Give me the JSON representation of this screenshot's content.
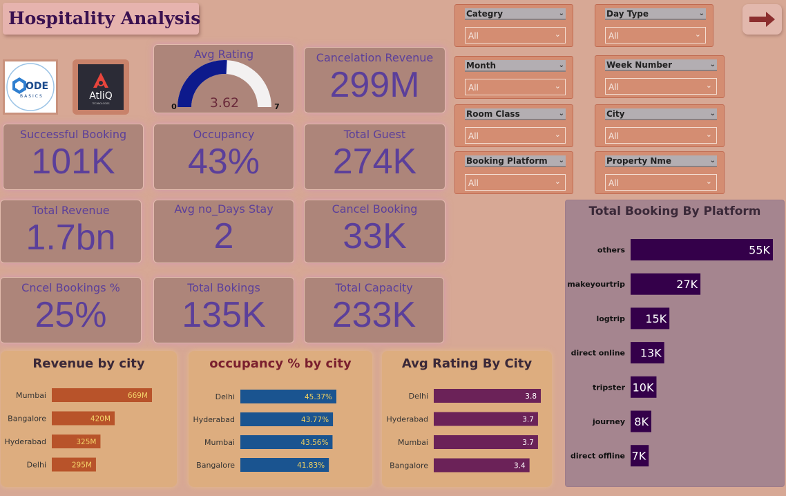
{
  "title": "Hospitality Analysis",
  "logos": {
    "codebasics_word1": "ODE",
    "codebasics_word2": "BASICS",
    "atliq": "AtliQ",
    "atliq_sub": "TECHNOLOGIES"
  },
  "kpis": {
    "avg_rating": {
      "label": "Avg Rating",
      "value": "3.62",
      "min": "0",
      "max": "7",
      "gauge_value": 3.62,
      "gauge_max": 7
    },
    "cancelation_revenue": {
      "label": "Cancelation Revenue",
      "value": "299M"
    },
    "successful_booking": {
      "label": "Successful Booking",
      "value": "101K"
    },
    "occupancy": {
      "label": "Occupancy",
      "value": "43%"
    },
    "total_guest": {
      "label": "Total Guest",
      "value": "274K"
    },
    "total_revenue": {
      "label": "Total Revenue",
      "value": "1.7bn"
    },
    "avg_days_stay": {
      "label": "Avg no_Days Stay",
      "value": "2"
    },
    "cancel_booking": {
      "label": "Cancel Booking",
      "value": "33K"
    },
    "cancel_bookings_pct": {
      "label": "Cncel Bookings %",
      "value": "25%"
    },
    "total_bookings": {
      "label": "Total Bokings",
      "value": "135K"
    },
    "total_capacity": {
      "label": "Total Capacity",
      "value": "233K"
    }
  },
  "filters": {
    "category": {
      "label": "Categry",
      "value": "All"
    },
    "day_type": {
      "label": "Day Type",
      "value": "All"
    },
    "month": {
      "label": "Month",
      "value": "All"
    },
    "week_number": {
      "label": "Week Number",
      "value": "All"
    },
    "room_class": {
      "label": "Room Class",
      "value": "All"
    },
    "city": {
      "label": "City",
      "value": "All"
    },
    "booking_platform": {
      "label": "Booking Platform",
      "value": "All"
    },
    "property_name": {
      "label": "Property Nme",
      "value": "All"
    }
  },
  "icons": {
    "arrow": "arrow-right-icon",
    "chevron": "chevron-down-icon"
  },
  "colors": {
    "title_text": "#3a1150",
    "kpi_text": "#5b3f9a",
    "platform_bar": "#34004a",
    "revenue_bar": "#b8532a",
    "occupancy_bar": "#1a5490",
    "rating_bar": "#6b2258",
    "gauge_fill": "#0d1a8c"
  },
  "chart_data": [
    {
      "type": "bar",
      "title": "Total Booking By Platform",
      "categories": [
        "others",
        "makeyourtrip",
        "logtrip",
        "direct online",
        "tripster",
        "journey",
        "direct offline"
      ],
      "values": [
        55,
        27,
        15,
        13,
        10,
        8,
        7
      ],
      "labels": [
        "55K",
        "27K",
        "15K",
        "13K",
        "10K",
        "8K",
        "7K"
      ],
      "orientation": "horizontal"
    },
    {
      "type": "bar",
      "title": "Revenue by city",
      "categories": [
        "Mumbai",
        "Bangalore",
        "Hyderabad",
        "Delhi"
      ],
      "values": [
        669,
        420,
        325,
        295
      ],
      "labels": [
        "669M",
        "420M",
        "325M",
        "295M"
      ],
      "orientation": "horizontal"
    },
    {
      "type": "bar",
      "title": "occupancy % by city",
      "categories": [
        "Delhi",
        "Hyderabad",
        "Mumbai",
        "Bangalore"
      ],
      "values": [
        45.37,
        43.77,
        43.56,
        41.83
      ],
      "labels": [
        "45.37%",
        "43.77%",
        "43.56%",
        "41.83%"
      ],
      "orientation": "horizontal"
    },
    {
      "type": "bar",
      "title": "Avg Rating By City",
      "categories": [
        "Delhi",
        "Hyderabad",
        "Mumbai",
        "Bangalore"
      ],
      "values": [
        3.8,
        3.7,
        3.7,
        3.4
      ],
      "labels": [
        "3.8",
        "3.7",
        "3.7",
        "3.4"
      ],
      "orientation": "horizontal"
    }
  ]
}
